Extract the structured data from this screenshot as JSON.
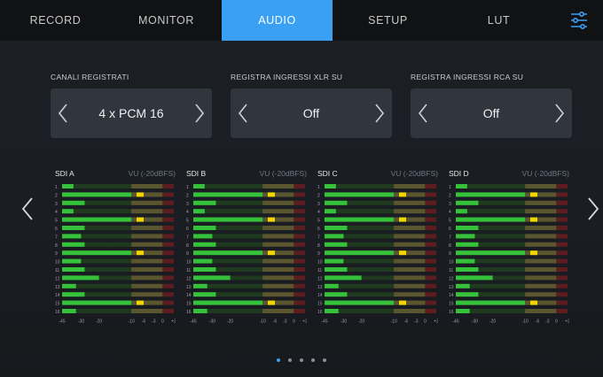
{
  "tabs": [
    {
      "label": "RECORD",
      "active": false
    },
    {
      "label": "MONITOR",
      "active": false
    },
    {
      "label": "AUDIO",
      "active": true
    },
    {
      "label": "SETUP",
      "active": false
    },
    {
      "label": "LUT",
      "active": false
    }
  ],
  "settings_icon": "sliders-icon",
  "selectors": [
    {
      "label": "CANALI REGISTRATI",
      "value": "4 x PCM 16"
    },
    {
      "label": "REGISTRA INGRESSI XLR SU",
      "value": "Off"
    },
    {
      "label": "REGISTRA INGRESSI RCA SU",
      "value": "Off"
    }
  ],
  "meter_scale": [
    "-45",
    "-30",
    "-20",
    "-10",
    "-6",
    "-3",
    "0",
    "+3"
  ],
  "meters": [
    {
      "name": "SDI A",
      "scale": "VU (-20dBFS)"
    },
    {
      "name": "SDI B",
      "scale": "VU (-20dBFS)"
    },
    {
      "name": "SDI C",
      "scale": "VU (-20dBFS)"
    },
    {
      "name": "SDI D",
      "scale": "VU (-20dBFS)"
    }
  ],
  "channel_numbers": [
    "1",
    "2",
    "3",
    "4",
    "5",
    "6",
    "7",
    "8",
    "9",
    "10",
    "11",
    "12",
    "13",
    "14",
    "15",
    "16"
  ],
  "channel_levels_db": [
    -36,
    -10,
    -28,
    -36,
    -8,
    -28,
    -30,
    -28,
    -10,
    -30,
    -28,
    -20,
    -34,
    -28,
    -10,
    -34
  ],
  "peak_channels": [
    2,
    5,
    9,
    15
  ],
  "page_dots": {
    "count": 5,
    "active": 0
  },
  "colors": {
    "accent": "#3aa0f4",
    "level": "#35c23a",
    "peak": "#f2d500",
    "over": "#a31c22"
  }
}
